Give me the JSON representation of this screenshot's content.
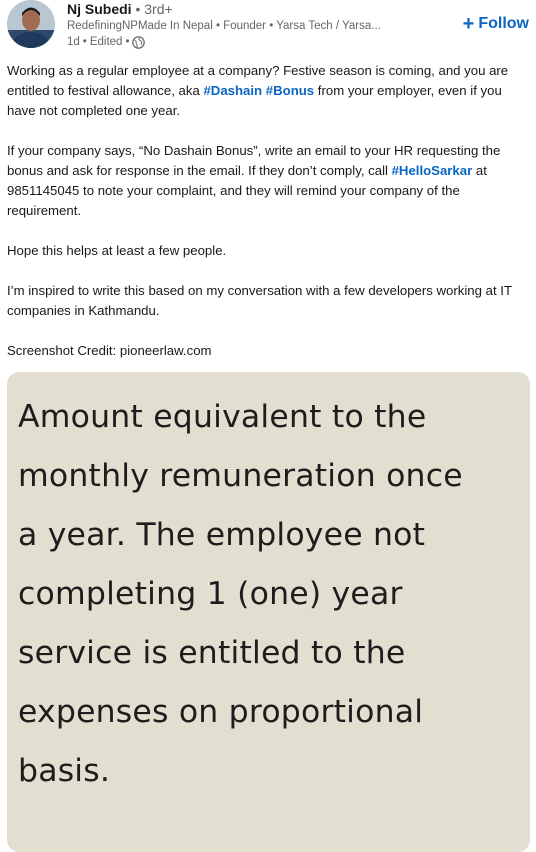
{
  "post": {
    "author": {
      "name": "Nj Subedi",
      "degree": "3rd+",
      "headline": "RedefiningNPMade In Nepal • Founder • Yarsa Tech / Yarsa...",
      "time": "1d",
      "edited": "Edited",
      "separator": "•"
    },
    "follow": {
      "label": "Follow",
      "icon": "+"
    },
    "body": {
      "p1_a": "Working as a regular employee at a company? Festive season is coming, and you are entitled to festival allowance, aka ",
      "p1_tag1": "#Dashain",
      "p1_space": " ",
      "p1_tag2": "#Bonus",
      "p1_b": " from your employer, even if you have not completed one year.",
      "p2_a": "If your company says, “No Dashain Bonus”, write an email to your HR requesting the bonus and ask for response in the email. If they don’t comply, call ",
      "p2_tag": "#HelloSarkar",
      "p2_b": " at 9851145045 to note your complaint, and they will remind your company of the requirement.",
      "p3": "Hope this helps at least a few people.",
      "p4": "I’m inspired to write this based on my conversation with a few developers working at IT companies in Kathmandu.",
      "p5": "Screenshot Credit: pioneerlaw.com"
    },
    "image": {
      "lines": [
        "Amount equivalent to the",
        "monthly remuneration once",
        "a year. The employee not",
        "completing 1 (one) year",
        "service is entitled to the",
        "expenses on proportional",
        "basis."
      ]
    }
  },
  "colors": {
    "link": "#0a66c2",
    "text": "#191919",
    "muted": "#666666",
    "image_bg": "#e2dfd0"
  },
  "icons": {
    "globe": "globe-icon",
    "plus": "plus-icon",
    "avatar": "avatar"
  }
}
